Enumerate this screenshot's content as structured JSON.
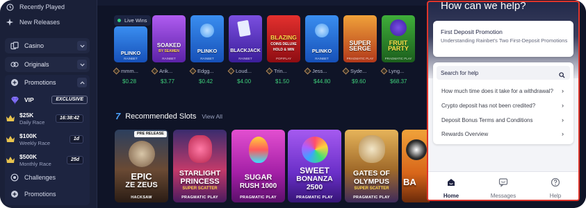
{
  "sidebar": {
    "links": [
      {
        "label": "Recently Played",
        "icon": "clock-icon"
      },
      {
        "label": "New Releases",
        "icon": "sparkle-icon"
      }
    ],
    "groups": [
      {
        "label": "Casino",
        "icon": "cards-icon"
      },
      {
        "label": "Originals",
        "icon": "originals-icon"
      },
      {
        "label": "Promotions",
        "icon": "gift-icon"
      }
    ],
    "vip": {
      "label": "VIP",
      "badge": "EXCLUSIVE"
    },
    "races": [
      {
        "title": "$25K",
        "sub": "Daily Race",
        "timer": "16:38:42"
      },
      {
        "title": "$100K",
        "sub": "Weekly Race",
        "timer": "1d"
      },
      {
        "title": "$500K",
        "sub": "Monthly Race",
        "timer": "25d"
      }
    ],
    "footer_links": [
      {
        "label": "Challenges",
        "icon": "target-icon"
      },
      {
        "label": "Promotions",
        "icon": "gift-icon"
      }
    ]
  },
  "live_wins": {
    "badge": "Live Wins",
    "items": [
      {
        "title": "PLINKO",
        "provider": "RAINBET",
        "user": "mmm...",
        "amount": "$0.28",
        "color": "#1f6fd6"
      },
      {
        "title": "SOAKED",
        "sub": "BY SEAMEN",
        "provider": "RAINBET",
        "user": "Arik...",
        "amount": "$3.77",
        "color": "#8a3fd8"
      },
      {
        "title": "PLINKO",
        "provider": "RAINBET",
        "user": "Edgg...",
        "amount": "$0.42",
        "color": "#1f6fd6"
      },
      {
        "title": "BLACKJACK",
        "provider": "RAINBET",
        "user": "Loud...",
        "amount": "$4.00",
        "color": "#6a3bd1"
      },
      {
        "title": "BLAZING",
        "sub": "COINS DELUXE HOLD & WIN",
        "provider": "POPIPLAY",
        "user": "Trin...",
        "amount": "$1.50",
        "color": "#c81b22"
      },
      {
        "title": "PLINKO",
        "provider": "RAINBET",
        "user": "Jess...",
        "amount": "$44.80",
        "color": "#1f6fd6"
      },
      {
        "title": "SUPER SERGE",
        "provider": "PRAGMATIC PLAY",
        "user": "Syde...",
        "amount": "$9.60",
        "color": "#c94a1b"
      },
      {
        "title": "FRUIT PARTY",
        "provider": "PRAGMATIC PLAY",
        "user": "Lyng...",
        "amount": "$68.37",
        "color": "#2e8c2a"
      }
    ]
  },
  "recommended": {
    "number": "7",
    "title": "Recommended Slots",
    "view_all": "View All",
    "items": [
      {
        "line1": "EPIC",
        "line2": "ZE ZEUS",
        "provider": "HACKSAW",
        "badge": "PRE RELEASE",
        "color": "#5a3a2a"
      },
      {
        "line1": "STARLIGHT",
        "line2": "PRINCESS",
        "sub": "SUPER SCATTER",
        "provider": "PRAGMATIC PLAY",
        "color": "#6d3a9c"
      },
      {
        "line1": "SUGAR",
        "line2": "RUSH 1000",
        "provider": "PRAGMATIC PLAY",
        "color": "#c43ab6"
      },
      {
        "line1": "SWEET",
        "line2": "BONANZA",
        "line3": "2500",
        "provider": "PRAGMATIC PLAY",
        "color": "#8a3fd8"
      },
      {
        "line1": "GATES OF",
        "line2": "OLYMPUS",
        "sub": "SUPER SCATTER",
        "provider": "PRAGMATIC PLAY",
        "color": "#b8742a"
      },
      {
        "line1": "BA",
        "provider": "",
        "color": "#e08b1c"
      }
    ]
  },
  "help_widget": {
    "title": "How can we help?",
    "first_deposit": {
      "title": "First Deposit Promotion",
      "desc": "Understanding Rainbet's Two First-Deposit Promotions"
    },
    "search_label": "Search for help",
    "faqs": [
      "How much time does it take for a withdrawal?",
      "Crypto deposit has not been credited?",
      "Deposit Bonus Terms and Conditions",
      "Rewards Overview"
    ],
    "nav": [
      {
        "label": "Home",
        "icon": "home-icon",
        "active": true
      },
      {
        "label": "Messages",
        "icon": "messages-icon"
      },
      {
        "label": "Help",
        "icon": "help-icon"
      }
    ]
  }
}
